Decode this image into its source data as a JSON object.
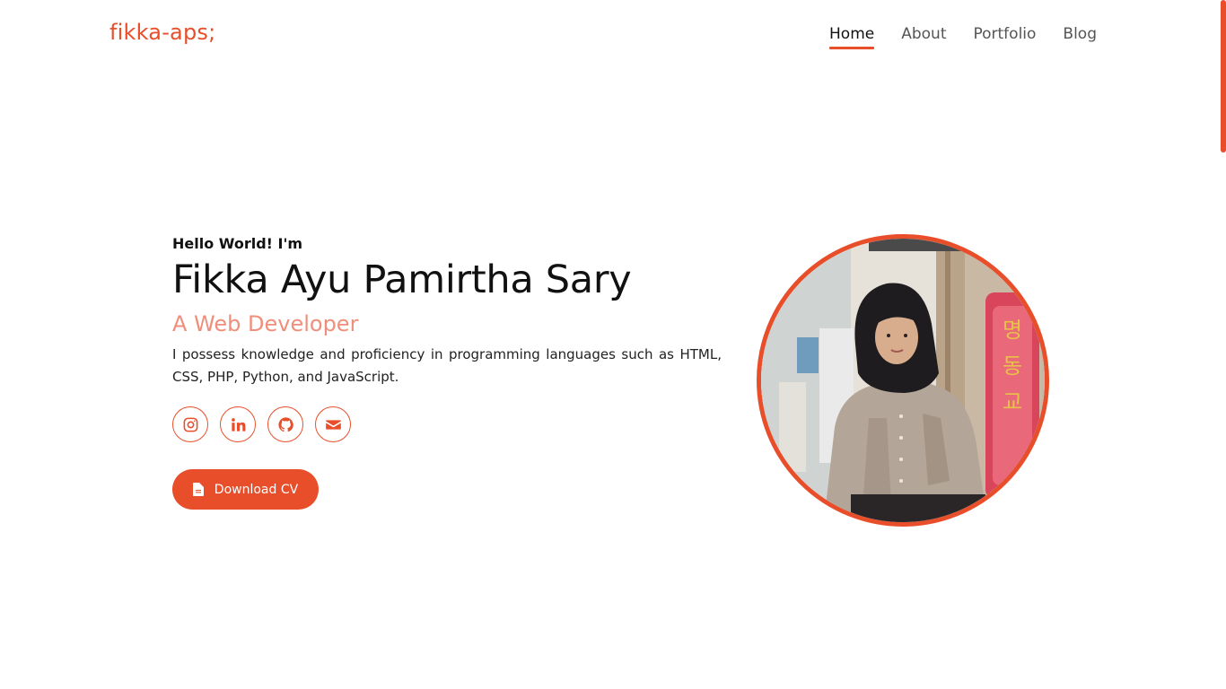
{
  "header": {
    "logo": "fikka-aps;",
    "nav": [
      {
        "label": "Home",
        "active": true
      },
      {
        "label": "About",
        "active": false
      },
      {
        "label": "Portfolio",
        "active": false
      },
      {
        "label": "Blog",
        "active": false
      }
    ]
  },
  "hero": {
    "greeting": "Hello World! I'm",
    "name": "Fikka Ayu Pamirtha Sary",
    "role": "A Web Developer",
    "bio": "I possess knowledge and proficiency in programming languages such as HTML, CSS, PHP, Python, and JavaScript.",
    "socials": [
      {
        "icon": "instagram-icon"
      },
      {
        "icon": "linkedin-icon"
      },
      {
        "icon": "github-icon"
      },
      {
        "icon": "envelope-icon"
      }
    ],
    "cv_button": {
      "label": "Download CV",
      "icon": "file-icon"
    }
  },
  "colors": {
    "accent": "#e94e2b",
    "role_text": "#ef8f7b",
    "nav_text": "#555555",
    "heading": "#111111"
  }
}
